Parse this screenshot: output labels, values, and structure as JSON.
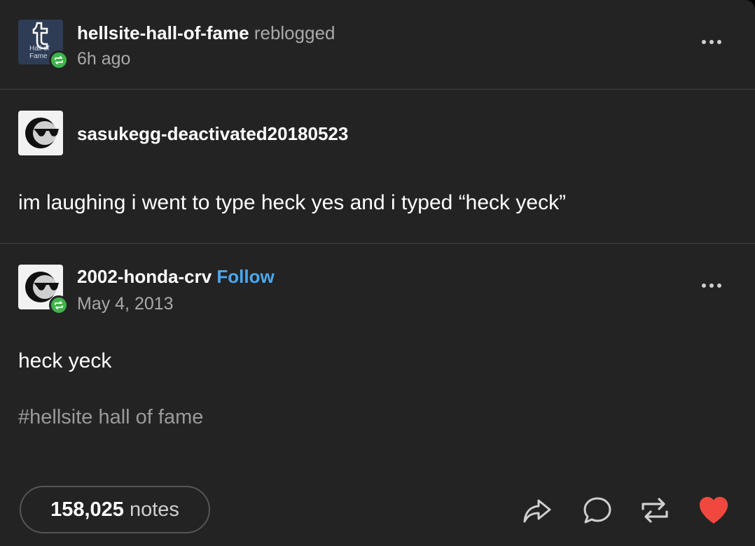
{
  "reblog_header": {
    "blog_name": "hellsite-hall-of-fame",
    "action_word": "reblogged",
    "time": "6h ago",
    "avatar_text_line1": "Hall of",
    "avatar_text_line2": "Fame"
  },
  "trail": [
    {
      "blog_name": "sasukegg-deactivated20180523",
      "text": "im laughing i went to type heck yes and i typed “heck yeck”"
    },
    {
      "blog_name": "2002-honda-crv",
      "follow_label": "Follow",
      "date": "May 4, 2013",
      "text": "heck yeck",
      "tag": "#hellsite hall of fame"
    }
  ],
  "footer": {
    "notes_count": "158,025",
    "notes_word": "notes"
  },
  "colors": {
    "background": "#232323",
    "reblog_green": "#3db44a",
    "follow_blue": "#4aa8f0",
    "like_red": "#f0483e"
  },
  "icons": [
    "tumblr-t-icon",
    "reblog-badge-icon",
    "sunglasses-avatar-icon",
    "more-options-icon",
    "share-icon",
    "reply-icon",
    "reblog-icon",
    "like-heart-icon"
  ]
}
